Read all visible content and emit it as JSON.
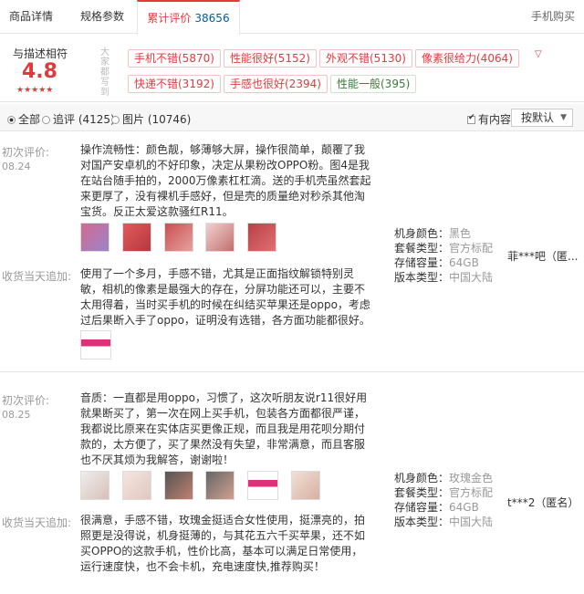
{
  "tabs": {
    "detail": "商品详情",
    "specs": "规格参数",
    "reviews_label": "累计评价",
    "reviews_count": "38656",
    "right_link": "手机购买"
  },
  "summary": {
    "rate_label": "与描述相符",
    "rate_score": "4.8",
    "stars": "★★★★★",
    "tag_heading": "大家都写到",
    "tags": [
      "手机不错(5870)",
      "性能很好(5152)",
      "外观不错(5130)",
      "像素很给力(4064)",
      "快递不错(3192)",
      "手感也很好(2394)",
      "性能一般(395)"
    ],
    "more_arrow": "▽"
  },
  "filter": {
    "all": "全部",
    "followup": "追评 (4125)",
    "images": "图片 (10746)",
    "has_content": "有内容",
    "sort": "按默认",
    "sort_caret": "▼"
  },
  "reviews": [
    {
      "first_label": "初次评价:",
      "first_date": "08.24",
      "first_text": "操作流畅性：颜色靓，够薄够大屏，操作很简单，颠覆了我对国产安卓机的不好印象，决定从果粉改OPPO粉。图4是我在站台随手拍的，2000万像素杠杠滴。送的手机壳虽然套起来更厚了，没有裸机手感好，但是壳的质量绝对秒杀其他淘宝货。反正太爱这款骚红R11。",
      "followup_label": "收货当天追加:",
      "followup_text": "使用了一个多月，手感不错，尤其是正面指纹解锁特别灵敏，相机的像素是最强大的存在，分屏功能还可以，主要不太用得着，当时买手机的时候在纠结买苹果还是oppo，考虑过后果断入手了oppo，证明没有选错，各方面功能都很好。",
      "specs": [
        {
          "k": "机身颜色：",
          "v": "黑色"
        },
        {
          "k": "套餐类型：",
          "v": "官方标配"
        },
        {
          "k": "存储容量：",
          "v": "64GB"
        },
        {
          "k": "版本类型：",
          "v": "中国大陆"
        }
      ],
      "user": "菲***吧（匿..."
    },
    {
      "first_label": "初次评价:",
      "first_date": "08.25",
      "first_text": "音质：一直都是用oppo，习惯了，这次听朋友说r11很好用就果断买了，第一次在网上买手机，包装各方面都很严谨，我都说比原来在实体店买更像正规，而且我是用花呗分期付款的，太方便了，买了果然没有失望，非常满意，而且客服也不厌其烦为我解答，谢谢啦！",
      "followup_label": "收货当天追加:",
      "followup_text": "很满意，手感不错，玫瑰金挺适合女性使用，挺漂亮的，拍照更是没得说，机身挺薄的，与其花五六千买苹果，还不如买OPPO的这款手机，性价比高，基本可以满足日常使用，运行速度快，也不会卡机，充电速度快,推荐购买！",
      "specs": [
        {
          "k": "机身颜色：",
          "v": "玫瑰金色"
        },
        {
          "k": "套餐类型：",
          "v": "官方标配"
        },
        {
          "k": "存储容量：",
          "v": "64GB"
        },
        {
          "k": "版本类型：",
          "v": "中国大陆"
        }
      ],
      "user": "t***2（匿名）"
    }
  ],
  "colors": {
    "accent": "#e4393c",
    "count_blue": "#005ea7"
  }
}
